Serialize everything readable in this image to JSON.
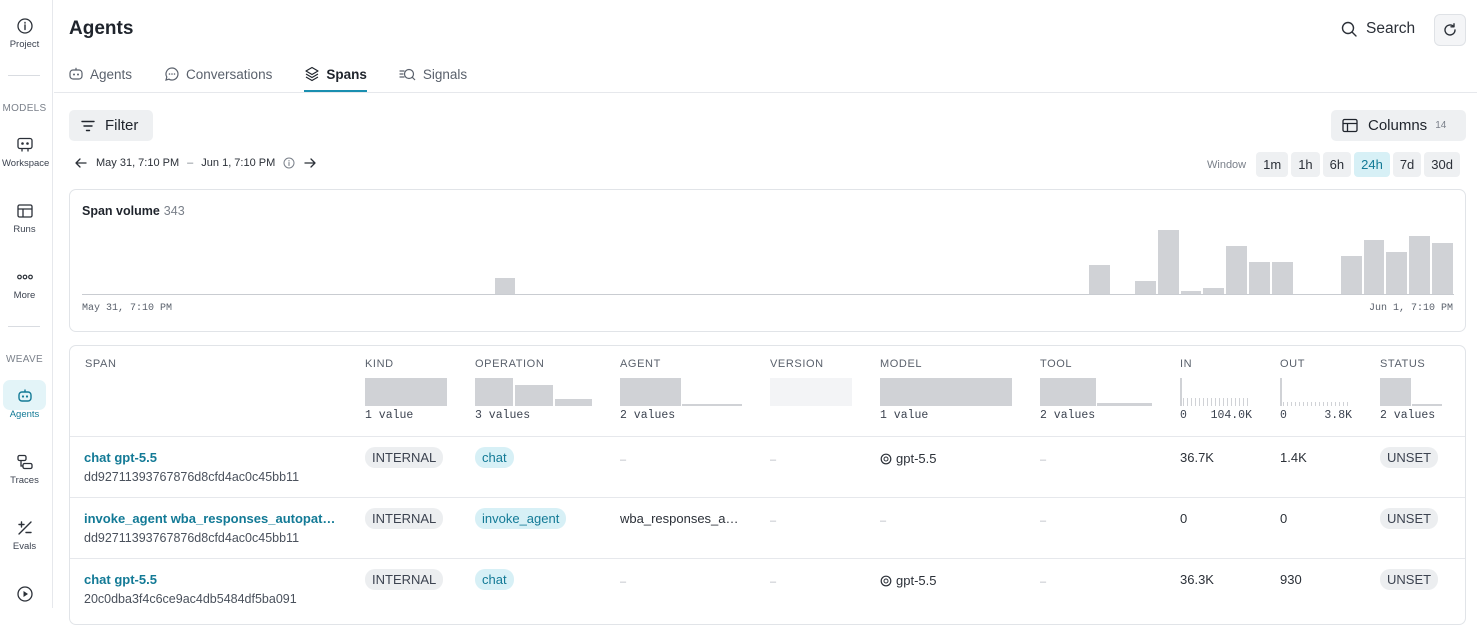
{
  "sidebar": {
    "items": [
      {
        "label": "Project",
        "icon": "info-icon"
      },
      {
        "label": "Workspace",
        "icon": "workspace-icon"
      },
      {
        "label": "Runs",
        "icon": "table-icon"
      },
      {
        "label": "More",
        "icon": "more-icon"
      },
      {
        "label": "Agents",
        "icon": "agent-icon"
      },
      {
        "label": "Traces",
        "icon": "traces-icon"
      },
      {
        "label": "Evals",
        "icon": "evals-icon"
      }
    ],
    "sections": {
      "models": "MODELS",
      "weave": "WEAVE"
    }
  },
  "header": {
    "title": "Agents",
    "search_label": "Search"
  },
  "tabs": [
    {
      "label": "Agents",
      "icon": "agent-icon",
      "active": false
    },
    {
      "label": "Conversations",
      "icon": "chat-bubble-icon",
      "active": false
    },
    {
      "label": "Spans",
      "icon": "layers-icon",
      "active": true
    },
    {
      "label": "Signals",
      "icon": "signals-icon",
      "active": false
    }
  ],
  "toolbar": {
    "filter_label": "Filter",
    "columns_label": "Columns",
    "columns_count": "14"
  },
  "daterange": {
    "start": "May 31, 7:10 PM",
    "sep": "–",
    "end": "Jun 1, 7:10 PM"
  },
  "window": {
    "label": "Window",
    "options": [
      "1m",
      "1h",
      "6h",
      "24h",
      "7d",
      "30d"
    ],
    "active": "24h"
  },
  "chart_data": {
    "type": "bar",
    "title": "Span volume",
    "total": "343",
    "x_start_label": "May 31, 7:10 PM",
    "x_end_label": "Jun 1, 7:10 PM",
    "bins": 60,
    "values": [
      0,
      0,
      0,
      0,
      0,
      0,
      0,
      0,
      0,
      0,
      0,
      0,
      0,
      0,
      0,
      0,
      0,
      0,
      0,
      0,
      0,
      0,
      0,
      0,
      0,
      0,
      0,
      0,
      0,
      0,
      0,
      0,
      0,
      0,
      0,
      0,
      0,
      0,
      0,
      0,
      0,
      0,
      0,
      0,
      0,
      0,
      0,
      0,
      0,
      0,
      0,
      0,
      0,
      0,
      0,
      0,
      0,
      0,
      0,
      0
    ],
    "series_values": {
      "18": 5,
      "44": 9,
      "46": 4,
      "47": 20,
      "48": 1,
      "49": 2,
      "50": 15,
      "51": 10,
      "52": 10,
      "55": 12,
      "56": 17,
      "57": 13,
      "58": 18,
      "59": 16
    },
    "ylim": [
      0,
      20
    ],
    "bar_color": "#d0d2d6"
  },
  "table": {
    "headers": [
      "SPAN",
      "KIND",
      "OPERATION",
      "AGENT",
      "VERSION",
      "MODEL",
      "TOOL",
      "IN",
      "OUT",
      "STATUS"
    ],
    "summaries": {
      "kind": "1 value",
      "operation": "3 values",
      "agent": "2 values",
      "model": "1 value",
      "tool": "2 values",
      "in_min": "0",
      "in_max": "104.0K",
      "out_min": "0",
      "out_max": "3.8K",
      "status": "2 values"
    },
    "rows": [
      {
        "name": "chat gpt-5.5",
        "id": "dd92711393767876d8cfd4ac0c45bb11",
        "kind": "INTERNAL",
        "operation": "chat",
        "agent": "–",
        "version": "–",
        "model": "gpt-5.5",
        "tool": "–",
        "in": "36.7K",
        "out": "1.4K",
        "status": "UNSET"
      },
      {
        "name": "invoke_agent wba_responses_autopat…",
        "id": "dd92711393767876d8cfd4ac0c45bb11",
        "kind": "INTERNAL",
        "operation": "invoke_agent",
        "agent": "wba_responses_a…",
        "version": "–",
        "model": "–",
        "tool": "–",
        "in": "0",
        "out": "0",
        "status": "UNSET"
      },
      {
        "name": "chat gpt-5.5",
        "id": "20c0dba3f4c6ce9ac4db5484df5ba091",
        "kind": "INTERNAL",
        "operation": "chat",
        "agent": "–",
        "version": "–",
        "model": "gpt-5.5",
        "tool": "–",
        "in": "36.3K",
        "out": "930",
        "status": "UNSET"
      }
    ]
  }
}
